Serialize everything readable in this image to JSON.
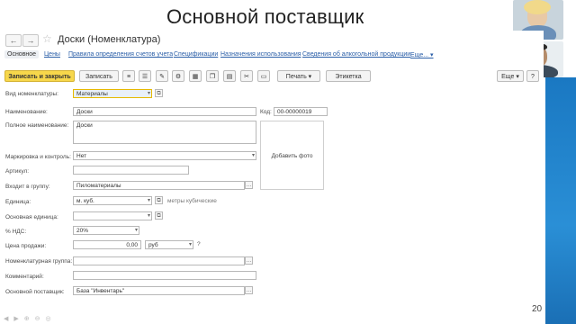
{
  "slide": {
    "title": "Основной поставщик",
    "page_number": "20"
  },
  "window": {
    "title": "Доски (Номенклатура)",
    "nav": {
      "back": "←",
      "forward": "→",
      "star": "☆"
    }
  },
  "tabs": [
    {
      "label": "Основное"
    },
    {
      "label": "Цены"
    },
    {
      "label": "Правила определения счетов учета"
    },
    {
      "label": "Спецификации"
    },
    {
      "label": "Назначения использования"
    },
    {
      "label": "Сведения об алкогольной продукции"
    },
    {
      "label": "Еще... ▾"
    }
  ],
  "toolbar": {
    "save_close": "Записать и закрыть",
    "save": "Записать",
    "print": "Печать ▾",
    "label": "Этикетка",
    "more": "Еще ▾",
    "help": "?"
  },
  "form": {
    "vid": {
      "label": "Вид номенклатуры:",
      "value": "Материалы"
    },
    "name": {
      "label": "Наименование:",
      "value": "Доски"
    },
    "code": {
      "label": "Код:",
      "value": "00-00000019"
    },
    "full_name": {
      "label": "Полное наименование:",
      "value": "Доски"
    },
    "marking": {
      "label": "Маркировка и контроль:",
      "value": "Нет"
    },
    "article": {
      "label": "Артикул:",
      "value": ""
    },
    "group": {
      "label": "Входит в группу:",
      "value": "Пиломатериалы"
    },
    "unit": {
      "label": "Единица:",
      "value": "м. куб.",
      "hint": "метры кубические"
    },
    "base_unit": {
      "label": "Основная единица:",
      "value": ""
    },
    "vat": {
      "label": "% НДС:",
      "value": "20%"
    },
    "price": {
      "label": "Цена продажи:",
      "value": "0,00",
      "currency": "руб",
      "q": "?"
    },
    "nom_group": {
      "label": "Номенклатурная группа:",
      "value": ""
    },
    "comment": {
      "label": "Комментарий:",
      "value": ""
    },
    "supplier": {
      "label": "Основной поставщик:",
      "value": "База \"Инвентарь\""
    },
    "photo": "Добавить фото"
  },
  "colors": {
    "accent": "#f7d74b",
    "link": "#2b5fa8",
    "blue_strip": "#1a78c2"
  }
}
